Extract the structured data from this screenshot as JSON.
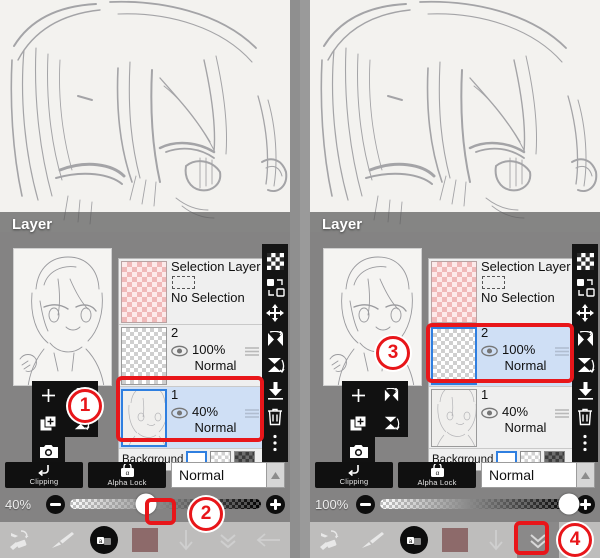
{
  "app": {
    "panel_title": "Layer",
    "accent_red": "#e8161a",
    "selected_blue": "#cfdff5",
    "swatch_color": "#8d6a6a"
  },
  "selection_layer": {
    "title": "Selection Layer",
    "status": "No Selection"
  },
  "background_row": {
    "label": "Background",
    "swatches": [
      "white",
      "transparent-checker",
      "dark-checker"
    ],
    "selected_index": 0
  },
  "controls": {
    "clipping_label": "Clipping",
    "alpha_lock_label": "Alpha Lock",
    "blend_mode": "Normal"
  },
  "left_pad_icons": [
    "add-layer-icon",
    "flip-horizontal-icon",
    "duplicate-layer-icon",
    "flip-vertical-icon",
    "camera-import-icon"
  ],
  "vertical_tools": [
    "transparency-checker-icon",
    "duplicate-transform-icon",
    "move-icon",
    "flip-horizontal-icon",
    "flip-vertical-icon",
    "merge-down-icon",
    "delete-layer-icon",
    "more-options-icon"
  ],
  "bottom_toolbar": [
    "undo-redo-eraser-icon",
    "brush-icon",
    "layers-blend-icon",
    "color-swatch",
    "down-arrow-icon",
    "chevron-down-icon",
    "back-arrow-icon"
  ],
  "panels": [
    {
      "id": "before",
      "layers": [
        {
          "name": "2",
          "opacity": "100%",
          "blend": "Normal",
          "selected": false,
          "thumb": "checker"
        },
        {
          "name": "1",
          "opacity": "40%",
          "blend": "Normal",
          "selected": true,
          "thumb": "art"
        }
      ],
      "opacity_value": "40%",
      "opacity_percent": 40,
      "blend_mode": "Normal"
    },
    {
      "id": "after",
      "layers": [
        {
          "name": "2",
          "opacity": "100%",
          "blend": "Normal",
          "selected": true,
          "thumb": "checker"
        },
        {
          "name": "1",
          "opacity": "40%",
          "blend": "Normal",
          "selected": false,
          "thumb": "art"
        }
      ],
      "opacity_value": "100%",
      "opacity_percent": 100,
      "blend_mode": "Normal"
    }
  ],
  "annotations": [
    {
      "number": "1",
      "target": "add-layer-button"
    },
    {
      "number": "2",
      "target": "opacity-slider-thumb"
    },
    {
      "number": "3",
      "target": "layer-2-row"
    },
    {
      "number": "4",
      "target": "chevron-down-button"
    }
  ]
}
